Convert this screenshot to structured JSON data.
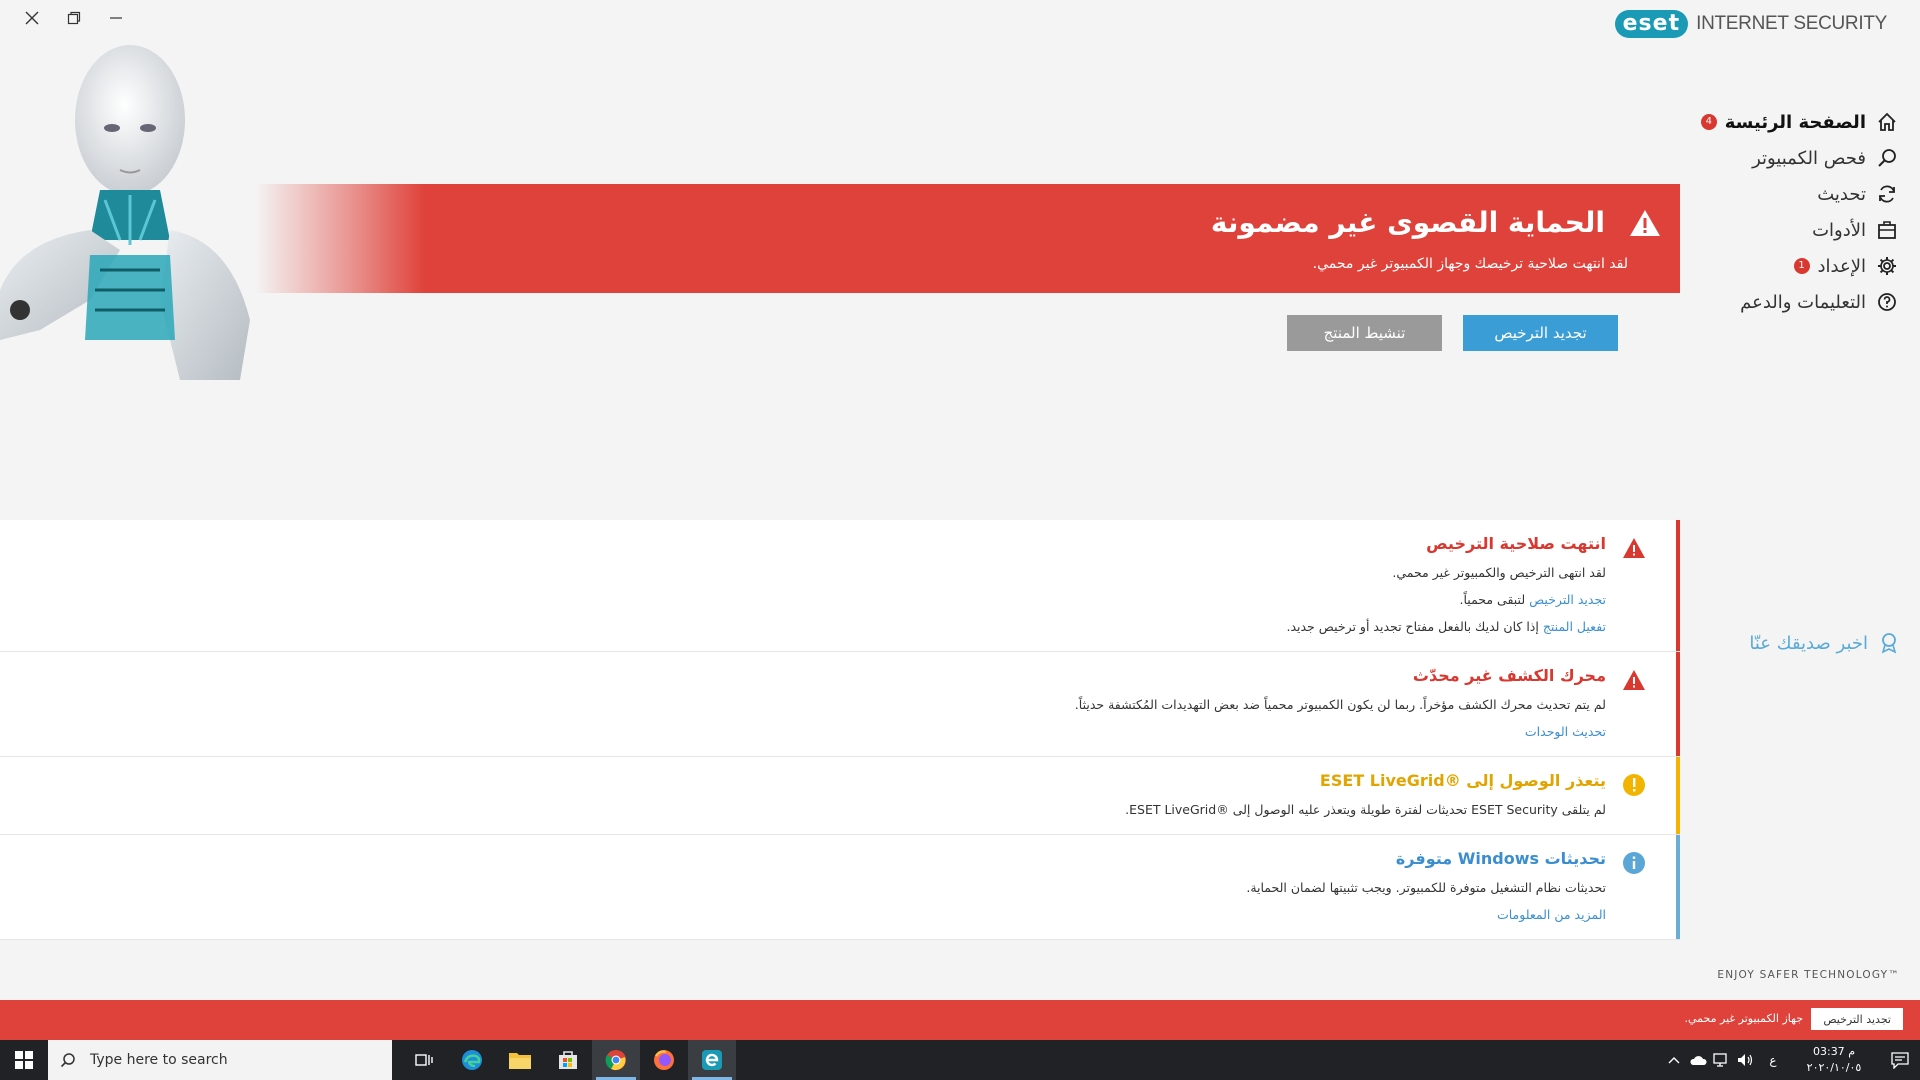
{
  "window": {
    "close_icon": "close-icon",
    "restore_icon": "restore-icon",
    "minimize_icon": "minimize-icon"
  },
  "brand": {
    "logo_mark": "eset",
    "product_name": "INTERNET SECURITY",
    "tagline": "ENJOY SAFER TECHNOLOGY™",
    "accent": "#df423a",
    "link_color": "#3a8ed0"
  },
  "nav": {
    "items": [
      {
        "label": "الصفحة الرئيسة",
        "icon": "home-icon",
        "badge": "4",
        "active": true
      },
      {
        "label": "فحص الكمبيوتر",
        "icon": "search-icon",
        "badge": "",
        "active": false
      },
      {
        "label": "تحديث",
        "icon": "refresh-icon",
        "badge": "",
        "active": false
      },
      {
        "label": "الأدوات",
        "icon": "briefcase-icon",
        "badge": "",
        "active": false
      },
      {
        "label": "الإعداد",
        "icon": "gear-icon",
        "badge": "1",
        "active": false
      },
      {
        "label": "التعليمات والدعم",
        "icon": "help-icon",
        "badge": "",
        "active": false
      }
    ],
    "tell_friend": "اخبر صديقك عنّا"
  },
  "banner": {
    "title": "الحماية القصوى غير مضمونة",
    "subtitle": "لقد انتهت صلاحية ترخيصك وجهاز الكمبيوتر غير محمي.",
    "icon": "warning-icon"
  },
  "actions": {
    "renew_label": "تجديد الترخيص",
    "activate_label": "تنشيط المنتج"
  },
  "notifications": [
    {
      "severity": "error",
      "title": "انتهت صلاحية الترخيص",
      "line1": "لقد انتهى الترخيص والكمبيوتر غير محمي.",
      "link2": "تجديد الترخيص",
      "rest2": " لتبقى محمياً.",
      "link3": "تفعيل المنتج",
      "rest3": " إذا كان لديك بالفعل مفتاح تجديد أو ترخيص جديد."
    },
    {
      "severity": "error",
      "title": "محرك الكشف غير محدّث",
      "line1": "لم يتم تحديث محرك الكشف مؤخراً. ربما لن يكون الكمبيوتر محمياً ضد بعض التهديدات المُكتشفة حديثاً.",
      "link2": "تحديث الوحدات"
    },
    {
      "severity": "warning",
      "title": "يتعذر الوصول إلى ®ESET LiveGrid",
      "line1": "لم يتلقى ESET Security تحديثات لفترة طويلة ويتعذر عليه الوصول إلى ®ESET LiveGrid."
    },
    {
      "severity": "info",
      "title": "تحديثات Windows متوفرة",
      "line1": "تحديثات نظام التشغيل متوفرة للكمبيوتر. ويجب تثبيتها لضمان الحماية.",
      "link2": "المزيد من المعلومات"
    }
  ],
  "status_strip": {
    "text": "جهاز الكمبيوتر غير محمي.",
    "button": "تجديد الترخيص"
  },
  "taskbar": {
    "search_placeholder": "Type here to search",
    "apps": [
      "task-view-icon",
      "edge-icon",
      "file-explorer-icon",
      "store-icon",
      "chrome-icon",
      "firefox-icon",
      "eset-icon"
    ],
    "lang": "ع",
    "time": "03:37 م",
    "date": "٢٠٢٠/١٠/٠٥"
  }
}
